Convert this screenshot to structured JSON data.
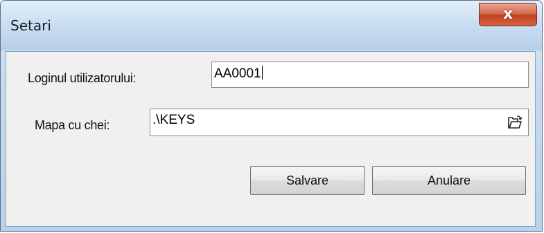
{
  "window": {
    "title": "Setari",
    "close_label": "x"
  },
  "form": {
    "login_label": "Loginul utilizatorului:",
    "login_value": "AA0001",
    "keys_label": "Mapa cu chei:",
    "keys_value": ".\\KEYS",
    "browse_icon": "folder-open-icon"
  },
  "buttons": {
    "save_label": "Salvare",
    "cancel_label": "Anulare"
  },
  "colors": {
    "titlebar": "#c7dbef",
    "client_bg": "#f0f0f0",
    "close_red": "#c0401f"
  }
}
